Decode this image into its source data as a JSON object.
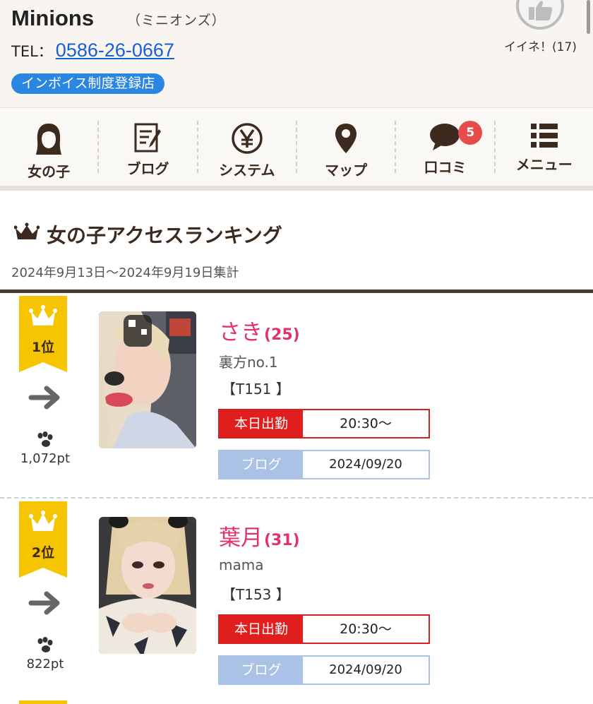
{
  "shop": {
    "name": "Minions",
    "kana": "（ミニオンズ）",
    "tel_prefix": "TEL：",
    "tel": "0586-26-0667",
    "invoice_badge": "インボイス制度登録店",
    "like_label": "イイネ！(17)"
  },
  "nav": {
    "items": [
      {
        "label": "女の子",
        "icon": "girl-icon"
      },
      {
        "label": "ブログ",
        "icon": "blog-icon"
      },
      {
        "label": "システム",
        "icon": "yen-icon"
      },
      {
        "label": "マップ",
        "icon": "map-pin-icon"
      },
      {
        "label": "口コミ",
        "icon": "speech-bubble-icon",
        "badge": "5"
      },
      {
        "label": "メニュー",
        "icon": "list-icon"
      }
    ]
  },
  "ranking": {
    "title": "女の子アクセスランキング",
    "period": "2024年9月13日～2024年9月19日集計",
    "entries": [
      {
        "rank": "1位",
        "trend": "arrow-right-icon",
        "points": "1,072pt",
        "name": "さき",
        "age": "(25)",
        "catch": "裏方no.1",
        "spec": "【T151 】",
        "work_tag": "本日出勤",
        "work_time": "20:30～",
        "blog_tag": "ブログ",
        "blog_date": "2024/09/20"
      },
      {
        "rank": "2位",
        "trend": "arrow-right-icon",
        "points": "822pt",
        "name": "葉月",
        "age": "(31)",
        "catch": "mama",
        "spec": "【T153 】",
        "work_tag": "本日出勤",
        "work_time": "20:30～",
        "blog_tag": "ブログ",
        "blog_date": "2024/09/20"
      }
    ]
  },
  "colors": {
    "accent_pink": "#e0336a",
    "work_red": "#e01e1e",
    "blog_blue": "#a9c2e6",
    "ribbon_gold": "#f6c400",
    "brown": "#3d2a1e",
    "link_blue": "#1a5fd0"
  }
}
